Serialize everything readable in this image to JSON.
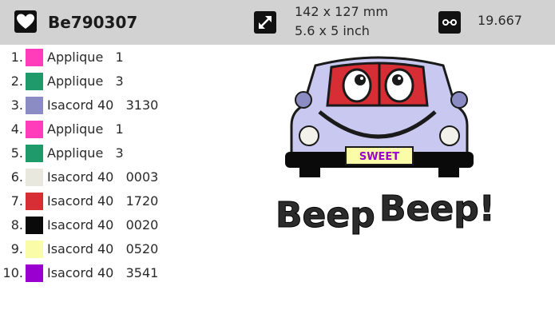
{
  "header": {
    "design_icon": "heart-icon",
    "design_name": "Be790307",
    "size_icon": "resize-arrows-icon",
    "size_mm": "142 x 127 mm",
    "size_inch": "5.6 x 5 inch",
    "stitch_icon": "stitch-count-icon",
    "stitch_count": "19.667"
  },
  "colors": [
    {
      "number": "1.",
      "name": "Applique   1",
      "swatch": "#ff3dbb"
    },
    {
      "number": "2.",
      "name": "Applique   3",
      "swatch": "#1f9a6a"
    },
    {
      "number": "3.",
      "name": "Isacord 40   3130",
      "swatch": "#8c8cc4"
    },
    {
      "number": "4.",
      "name": "Applique   1",
      "swatch": "#ff3dbb"
    },
    {
      "number": "5.",
      "name": "Applique   3",
      "swatch": "#1f9a6a"
    },
    {
      "number": "6.",
      "name": "Isacord 40   0003",
      "swatch": "#e8e8df"
    },
    {
      "number": "7.",
      "name": "Isacord 40   1720",
      "swatch": "#d72e35"
    },
    {
      "number": "8.",
      "name": "Isacord 40   0020",
      "swatch": "#0a0a0a"
    },
    {
      "number": "9.",
      "name": "Isacord 40   0520",
      "swatch": "#fbfca8"
    },
    {
      "number": "10.",
      "name": "Isacord 40   3541",
      "swatch": "#9a00d0"
    }
  ],
  "design": {
    "plate_text": "SWEET",
    "slogan_word1": "Beep",
    "slogan_word2": "Beep!"
  }
}
